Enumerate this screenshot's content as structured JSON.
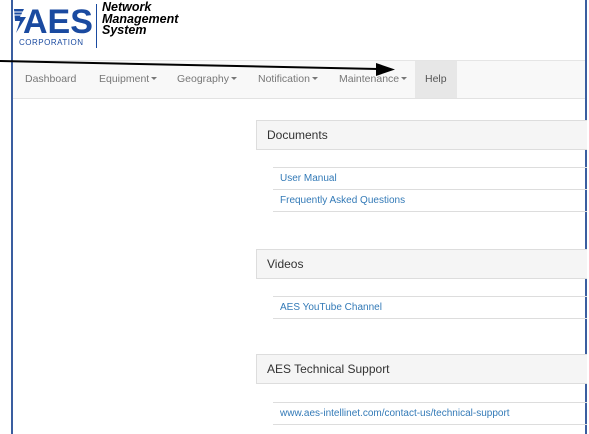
{
  "logo": {
    "brand": "AES",
    "corporation": "CORPORATION",
    "tagline_line1": "Network",
    "tagline_line2": "Management",
    "tagline_line3": "System",
    "brand_color": "#1a4aa0"
  },
  "nav": {
    "dashboard": "Dashboard",
    "equipment": "Equipment",
    "geography": "Geography",
    "notification": "Notification",
    "maintenance": "Maintenance",
    "help": "Help"
  },
  "sections": {
    "documents": {
      "heading": "Documents",
      "links": [
        "User Manual",
        "Frequently Asked Questions"
      ]
    },
    "videos": {
      "heading": "Videos",
      "links": [
        "AES YouTube Channel"
      ]
    },
    "support": {
      "heading": "AES Technical Support",
      "links": [
        "www.aes-intellinet.com/contact-us/technical-support"
      ]
    }
  },
  "colors": {
    "frame_border": "#3a5ea0",
    "link": "#337ab7",
    "nav_text": "#777777",
    "active_tab_bg": "#e7e7e7"
  }
}
